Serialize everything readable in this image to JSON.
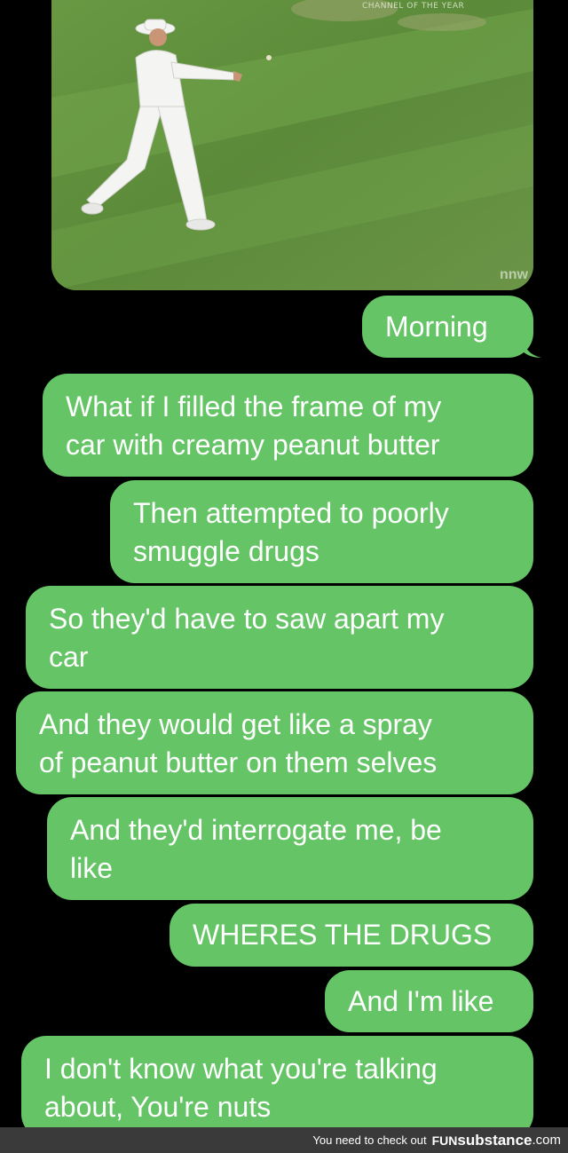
{
  "media": {
    "caption": "CHANNEL OF THE YEAR",
    "watermark": "nnw",
    "icon": "video-thumbnail"
  },
  "messages": [
    {
      "text": "Morning",
      "lines": [
        "Morning"
      ]
    },
    {
      "text": "What if I filled the frame of my car with creamy peanut butter",
      "lines": [
        "What if I filled the frame of my",
        "car with creamy peanut butter"
      ]
    },
    {
      "text": "Then attempted to poorly smuggle drugs",
      "lines": [
        "Then attempted to poorly",
        "smuggle drugs"
      ]
    },
    {
      "text": "So they'd have to saw apart my car",
      "lines": [
        "So they'd have to saw apart my",
        "car"
      ]
    },
    {
      "text": "And they would get like a spray of peanut butter on them selves",
      "lines": [
        "And they would get like a spray",
        "of peanut butter on them selves"
      ]
    },
    {
      "text": "And they'd interrogate me, be like",
      "lines": [
        "And they'd interrogate me, be",
        "like"
      ]
    },
    {
      "text": "WHERES THE DRUGS",
      "lines": [
        "WHERES THE DRUGS"
      ]
    },
    {
      "text": "And I'm like",
      "lines": [
        "And I'm like"
      ]
    },
    {
      "text": "I don't know what you're talking about, You're nuts",
      "lines": [
        "I don't know what you're talking",
        "about, You're nuts"
      ]
    }
  ],
  "footer": {
    "text": "You need to check out",
    "brand_prefix": "FUN",
    "brand_main": "substance",
    "brand_suffix": ".com"
  },
  "colors": {
    "bubble": "#65c466",
    "background": "#000000",
    "footer": "#3a3a3a"
  }
}
